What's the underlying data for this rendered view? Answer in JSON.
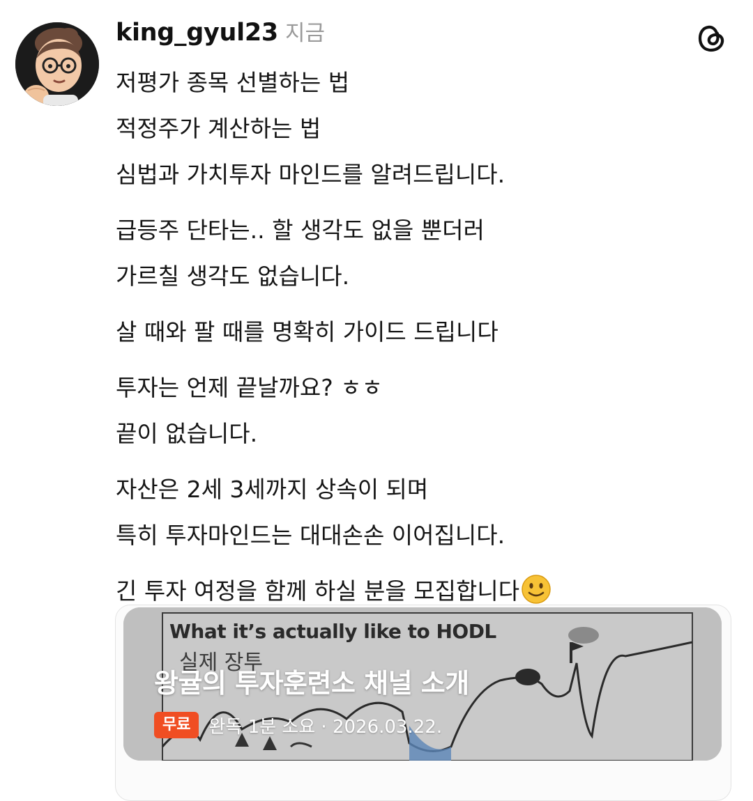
{
  "post": {
    "username": "king_gyul23",
    "timestamp": "지금",
    "paragraphs": [
      [
        "저평가 종목 선별하는 법",
        "적정주가 계산하는 법",
        "심법과 가치투자 마인드를 알려드립니다."
      ],
      [
        "급등주 단타는.. 할 생각도 없을 뿐더러",
        "가르칠 생각도 없습니다."
      ],
      [
        "살 때와 팔 때를 명확히 가이드 드립니다"
      ],
      [
        "투자는 언제 끝날까요? ㅎㅎ",
        "끝이 없습니다."
      ],
      [
        "자산은 2세 3세까지 상속이 되며",
        "특히 투자마인드는 대대손손 이어집니다."
      ],
      [
        "긴 투자 여정을 함께 하실 분을 모집합니다"
      ]
    ]
  },
  "card": {
    "bg_heading": "What it’s actually like to HODL",
    "bg_sub": "실제 장투",
    "title": "왕귤의 투자훈련소 채널 소개",
    "badge": "무료",
    "meta": "완독 1분 소요 · 2026.03.22."
  },
  "icons": {
    "app": "threads-icon",
    "emoji": "slightly-smiling-face-icon"
  },
  "colors": {
    "badge": "#f04e23",
    "timestamp": "#9a9a9a"
  }
}
